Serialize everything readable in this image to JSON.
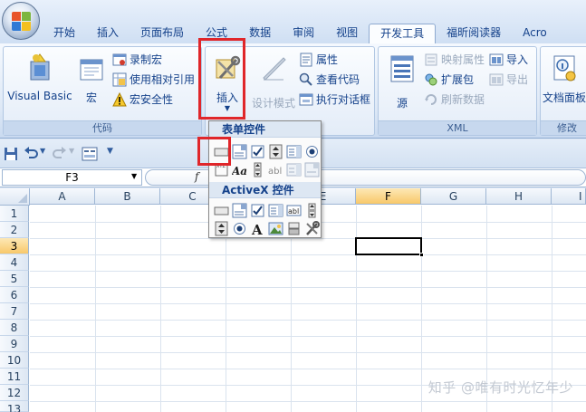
{
  "tabs": [
    "开始",
    "插入",
    "页面布局",
    "公式",
    "数据",
    "审阅",
    "视图",
    "开发工具",
    "福昕阅读器",
    "Acro"
  ],
  "active_tab": "开发工具",
  "ribbon": {
    "code_group": {
      "label": "代码",
      "visual_basic": "Visual Basic",
      "macros": "宏",
      "record_macro": "录制宏",
      "relative_ref": "使用相对引用",
      "macro_security": "宏安全性"
    },
    "controls_group": {
      "insert": "插入",
      "design_mode": "设计模式",
      "properties": "属性",
      "view_code": "查看代码",
      "run_dialog": "执行对话框"
    },
    "xml_group": {
      "label": "XML",
      "source": "源",
      "map_properties": "映射属性",
      "expansion_packs": "扩展包",
      "refresh_data": "刷新数据",
      "import": "导入",
      "export": "导出"
    },
    "modify_group": {
      "label": "修改",
      "doc_panel": "文档面板"
    }
  },
  "name_box": "F3",
  "columns": [
    "A",
    "B",
    "C",
    "D",
    "E",
    "F",
    "G",
    "H",
    "I"
  ],
  "rows": [
    "1",
    "2",
    "3",
    "4",
    "5",
    "6",
    "7",
    "8",
    "9",
    "10",
    "11",
    "12",
    "13"
  ],
  "dropdown": {
    "form_controls_title": "表单控件",
    "activex_title": "ActiveX 控件",
    "form_icons": [
      "button-icon",
      "combo-box-icon",
      "checkbox-icon",
      "spin-button-icon",
      "list-box-icon",
      "option-button-icon",
      "group-box-icon",
      "label-icon",
      "scroll-bar-icon",
      "text-field-icon",
      "combo-list-edit-icon",
      "combo-drop-down-edit-icon"
    ],
    "activex_icons": [
      "button-icon",
      "combo-box-icon",
      "checkbox-icon",
      "list-box-icon",
      "text-box-icon",
      "scroll-bar-icon",
      "spin-button-icon",
      "option-button-icon",
      "label-icon",
      "image-icon",
      "toggle-button-icon",
      "more-controls-icon"
    ]
  },
  "watermark": "知乎 @唯有时光忆年少",
  "colors": {
    "highlight_red": "#e0262a",
    "accent_blue": "#15428b"
  }
}
